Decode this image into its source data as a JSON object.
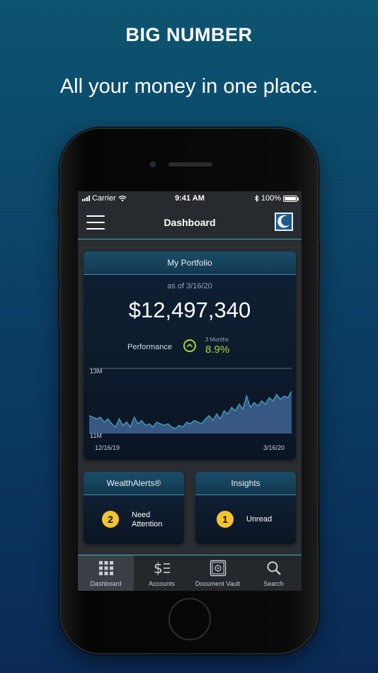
{
  "promo": {
    "title": "BIG NUMBER",
    "subtitle": "All your money in one place."
  },
  "status_bar": {
    "carrier": "Carrier",
    "time": "9:41 AM",
    "battery": "100%"
  },
  "nav": {
    "title": "Dashboard"
  },
  "portfolio": {
    "header": "My Portfolio",
    "as_of": "as of 3/16/20",
    "value": "$12,497,340",
    "performance_label": "Performance",
    "performance_period": "3 Months",
    "performance_value": "8.9%"
  },
  "chart_data": {
    "type": "area",
    "y_labels": [
      "13M",
      "11M"
    ],
    "ylim": [
      11,
      13
    ],
    "x_labels": [
      "12/16/19",
      "3/16/20"
    ],
    "values": [
      11.55,
      11.5,
      11.45,
      11.5,
      11.35,
      11.45,
      11.3,
      11.2,
      11.45,
      11.25,
      11.35,
      11.2,
      11.5,
      11.3,
      11.4,
      11.25,
      11.3,
      11.2,
      11.35,
      11.3,
      11.25,
      11.3,
      11.2,
      11.15,
      11.25,
      11.2,
      11.35,
      11.3,
      11.4,
      11.35,
      11.3,
      11.45,
      11.55,
      11.4,
      11.6,
      11.45,
      11.7,
      11.6,
      11.8,
      11.7,
      11.9,
      11.75,
      12.15,
      11.8,
      11.95,
      11.85,
      12.0,
      11.9,
      12.1,
      12.0,
      12.2,
      12.05,
      12.15,
      12.1,
      12.3
    ],
    "colors": {
      "line": "#3f9bb8",
      "fill": "#3d5f8e"
    }
  },
  "wealth_alerts": {
    "header": "WealthAlerts®",
    "count": "2",
    "text_line1": "Need",
    "text_line2": "Attention"
  },
  "insights": {
    "header": "Insights",
    "count": "1",
    "text": "Unread"
  },
  "tabs": [
    {
      "label": "Dashboard",
      "icon": "grid-icon",
      "active": true
    },
    {
      "label": "Accounts",
      "icon": "dollar-list-icon",
      "active": false
    },
    {
      "label": "Document Vault",
      "icon": "vault-icon",
      "active": false
    },
    {
      "label": "Search",
      "icon": "search-icon",
      "active": false
    }
  ],
  "colors": {
    "accent": "#3fb6b0",
    "performance": "#a8d63c",
    "badge": "#f4c430"
  }
}
